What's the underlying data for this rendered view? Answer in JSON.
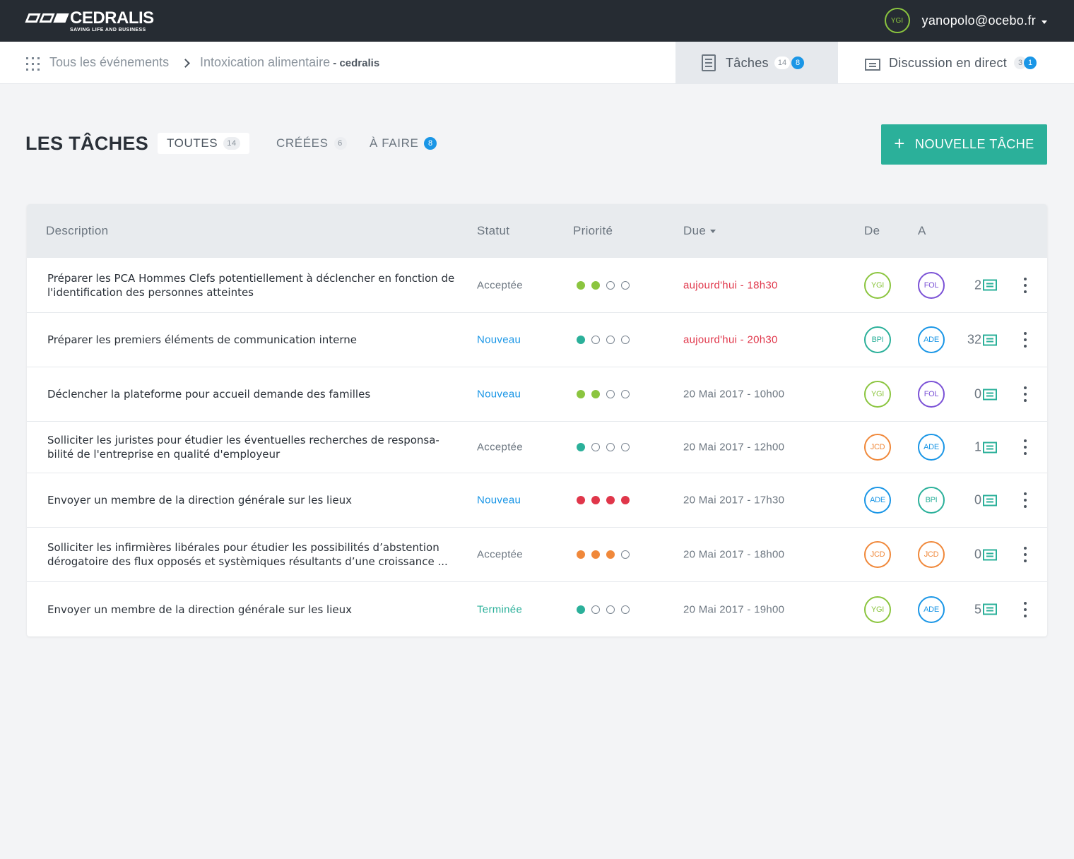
{
  "header": {
    "logo_name": "CEDRALIS",
    "logo_tagline": "SAVING LIFE AND BUSINESS",
    "user_initials": "YGI",
    "user_email": "yanopolo@ocebo.fr"
  },
  "breadcrumb": {
    "root": "Tous les événements",
    "current": "Intoxication alimentaire",
    "org_prefix": " - ",
    "org": "cedralis"
  },
  "tabs": {
    "tasks": {
      "label": "Tâches",
      "count": "14",
      "badge": "8"
    },
    "chat": {
      "label": "Discussion en direct",
      "count": "3",
      "badge": "1"
    }
  },
  "section": {
    "title": "LES TÂCHES",
    "filters": [
      {
        "label": "TOUTES",
        "count": "14"
      },
      {
        "label": "CRÉÉES",
        "count": "6"
      },
      {
        "label": "À FAIRE",
        "badge": "8"
      }
    ],
    "new_button": "NOUVELLE TÂCHE"
  },
  "table": {
    "headers": {
      "description": "Description",
      "status": "Statut",
      "priority": "Priorité",
      "due": "Due",
      "from": "De",
      "to": "A"
    },
    "rows": [
      {
        "description": "Préparer les PCA Hommes Clefs potentiellement à déclencher en fonction de l'identification des personnes atteintes",
        "status": "Acceptée",
        "priority_level": 2,
        "priority_color": "#8bc53f",
        "due": "aujourd'hui - 18h30",
        "from": "YGI",
        "to": "FOL",
        "comments": "2"
      },
      {
        "description": "Préparer les premiers éléments de communication interne",
        "status": "Nouveau",
        "priority_level": 1,
        "priority_color": "#2bb09a",
        "due": "aujourd'hui - 20h30",
        "from": "BPI",
        "to": "ADE",
        "comments": "32"
      },
      {
        "description": "Déclencher la plateforme pour accueil demande des familles",
        "status": "Nouveau",
        "priority_level": 2,
        "priority_color": "#8bc53f",
        "due": "20 Mai 2017 - 10h00",
        "from": "YGI",
        "to": "FOL",
        "comments": "0"
      },
      {
        "description": "Solliciter les juristes pour étudier les éventuelles recherches de responsa-bilité de l'entreprise en qualité d'employeur",
        "status": "Acceptée",
        "priority_level": 1,
        "priority_color": "#2bb09a",
        "due": "20 Mai 2017 - 12h00",
        "from": "JCD",
        "to": "ADE",
        "comments": "1"
      },
      {
        "description": "Envoyer un membre de la direction générale sur les lieux",
        "status": "Nouveau",
        "priority_level": 4,
        "priority_color": "#e0364a",
        "due": "20 Mai 2017 - 17h30",
        "from": "ADE",
        "to": "BPI",
        "comments": "0"
      },
      {
        "description": "Solliciter les infirmières libérales pour étudier les possibilités d’abstention dérogatoire des flux opposés et systèmiques résultants d’une croissance ...",
        "status": "Acceptée",
        "priority_level": 3,
        "priority_color": "#f0883a",
        "due": "20 Mai 2017 - 18h00",
        "from": "JCD",
        "to": "JCD",
        "comments": "0"
      },
      {
        "description": "Envoyer un membre de la direction générale sur les lieux",
        "status": "Terminée",
        "priority_level": 1,
        "priority_color": "#2bb09a",
        "due": "20 Mai 2017 - 19h00",
        "from": "YGI",
        "to": "ADE",
        "comments": "5"
      }
    ]
  },
  "colors": {
    "accent": "#2bb09a",
    "badge_blue": "#1a96e6",
    "late": "#e0364a",
    "user_YGI": "#8bc53f",
    "user_FOL": "#7b52d6",
    "user_BPI": "#2bb09a",
    "user_ADE": "#1a96e6",
    "user_JCD": "#f0883a"
  }
}
